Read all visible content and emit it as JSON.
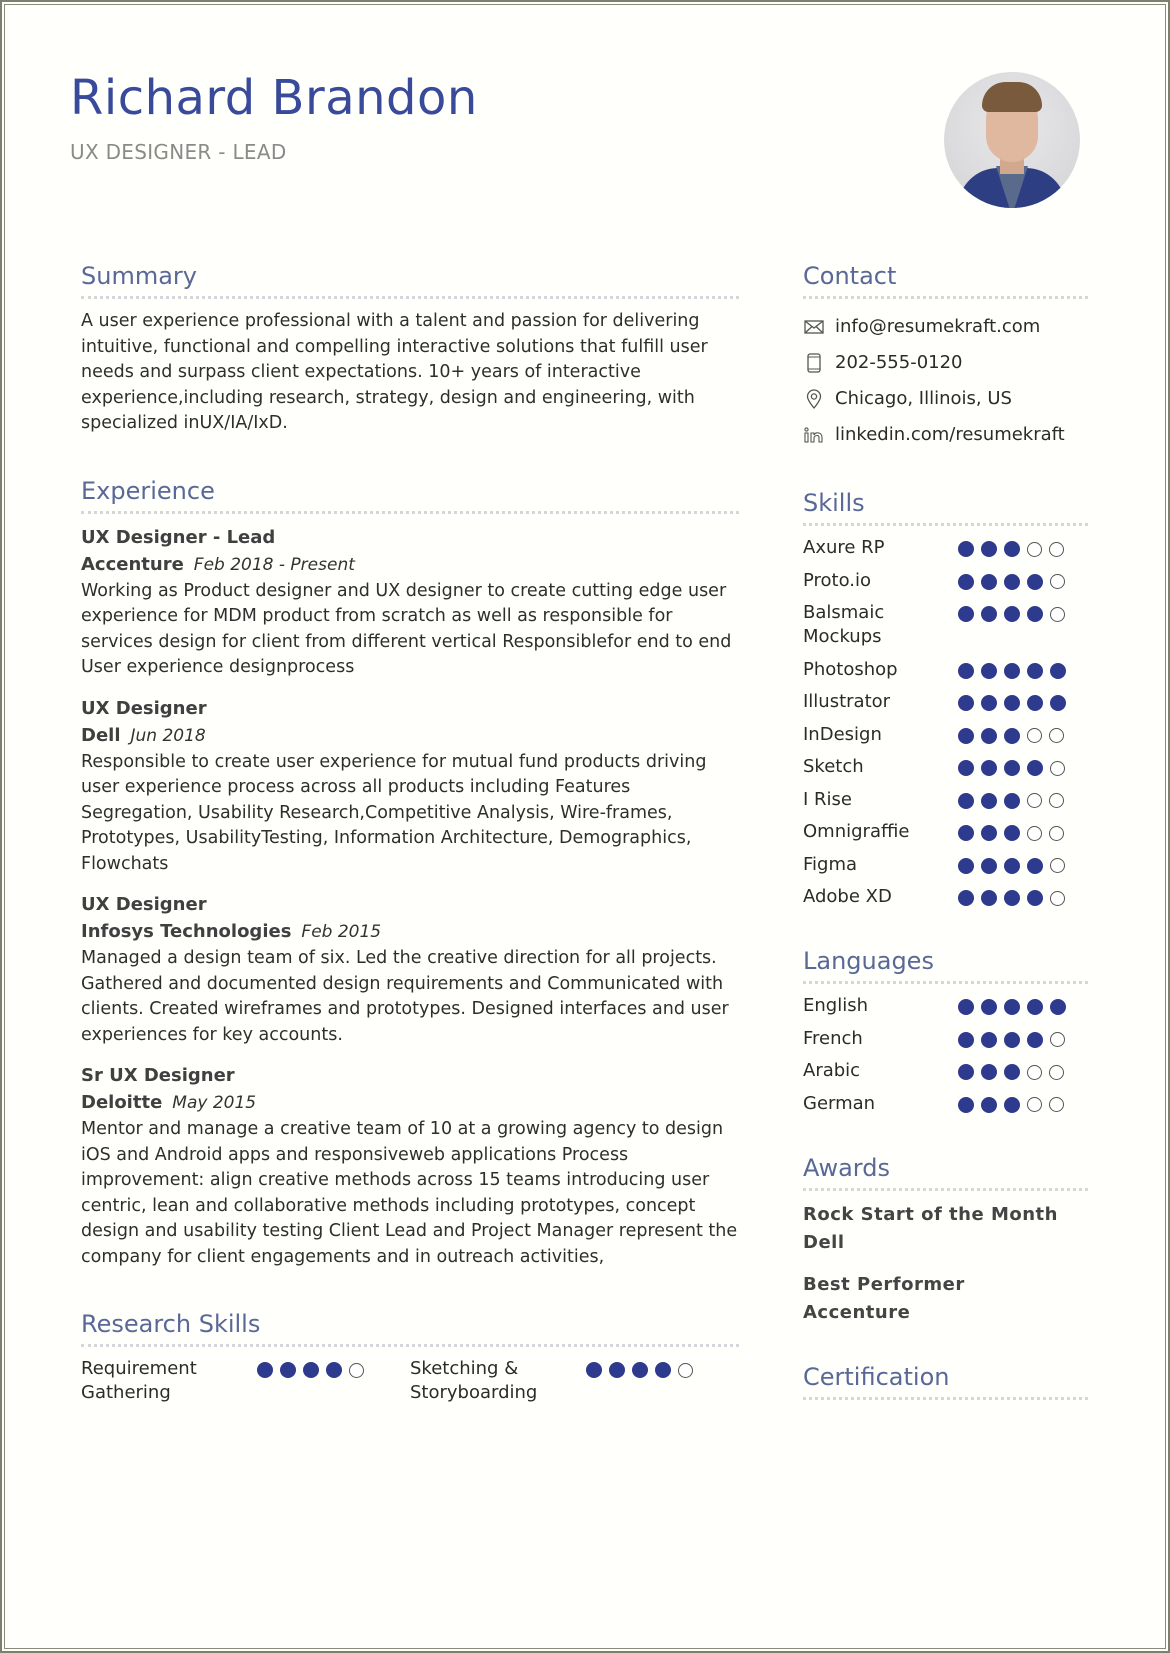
{
  "header": {
    "name": "Richard Brandon",
    "title": "UX DESIGNER - LEAD",
    "photo_icon": "profile-photo"
  },
  "colors": {
    "accent": "#3a4a9a",
    "heading": "#5a6898",
    "dot_filled": "#2e3a8e"
  },
  "summary": {
    "heading": "Summary",
    "text": "A user experience professional with a talent and passion for delivering intuitive, functional and compelling interactive solutions that fulfill user needs and surpass client expectations. 10+ years of interactive experience,including research, strategy, design and engineering, with specialized inUX/IA/IxD."
  },
  "experience": {
    "heading": "Experience",
    "jobs": [
      {
        "title": "UX Designer - Lead",
        "company": "Accenture",
        "date": "Feb 2018 - Present",
        "description": "Working as Product designer and UX designer to create cutting edge user experience for MDM product from scratch as well as responsible for services design for client from different vertical Responsiblefor end to end User experience designprocess"
      },
      {
        "title": "UX Designer",
        "company": "Dell",
        "date": "Jun 2018",
        "description": "Responsible to create user experience for mutual fund products driving user experience process across all products including Features Segregation, Usability Research,Competitive Analysis, Wire-frames, Prototypes, UsabilityTesting, Information Architecture, Demographics, Flowchats"
      },
      {
        "title": "UX Designer",
        "company": "Infosys Technologies",
        "date": "Feb 2015",
        "description": "Managed a design team of six. Led the creative direction for all projects. Gathered and documented design requirements and Communicated with clients. Created wireframes and prototypes. Designed interfaces and user experiences for key accounts."
      },
      {
        "title": "Sr UX Designer",
        "company": "Deloitte",
        "date": "May 2015",
        "description": "Mentor and manage a creative team of 10 at a growing agency to design iOS and Android apps and responsiveweb applications Process improvement: align creative methods across 15 teams introducing user centric, lean and collaborative methods including prototypes, concept design and usability testing Client Lead and Project Manager represent the company for client engagements and in outreach activities,"
      }
    ]
  },
  "research_skills": {
    "heading": "Research Skills",
    "items": [
      {
        "label": "Requirement Gathering",
        "rating": 4,
        "max": 5
      },
      {
        "label": "Sketching & Storyboarding",
        "rating": 4,
        "max": 5
      }
    ]
  },
  "contact": {
    "heading": "Contact",
    "items": [
      {
        "icon": "email-icon",
        "text": "info@resumekraft.com"
      },
      {
        "icon": "phone-icon",
        "text": "202-555-0120"
      },
      {
        "icon": "location-icon",
        "text": "Chicago, Illinois, US"
      },
      {
        "icon": "linkedin-icon",
        "text": "linkedin.com/resumekraft"
      }
    ]
  },
  "skills": {
    "heading": "Skills",
    "items": [
      {
        "label": "Axure RP",
        "rating": 3,
        "max": 5
      },
      {
        "label": "Proto.io",
        "rating": 4,
        "max": 5
      },
      {
        "label": "Balsmaic Mockups",
        "rating": 4,
        "max": 5
      },
      {
        "label": "Photoshop",
        "rating": 5,
        "max": 5
      },
      {
        "label": "Illustrator",
        "rating": 5,
        "max": 5
      },
      {
        "label": "InDesign",
        "rating": 3,
        "max": 5
      },
      {
        "label": "Sketch",
        "rating": 4,
        "max": 5
      },
      {
        "label": "I Rise",
        "rating": 3,
        "max": 5
      },
      {
        "label": "Omnigraffie",
        "rating": 3,
        "max": 5
      },
      {
        "label": "Figma",
        "rating": 4,
        "max": 5
      },
      {
        "label": "Adobe XD",
        "rating": 4,
        "max": 5
      }
    ]
  },
  "languages": {
    "heading": "Languages",
    "items": [
      {
        "label": "English",
        "rating": 5,
        "max": 5
      },
      {
        "label": "French",
        "rating": 4,
        "max": 5
      },
      {
        "label": "Arabic",
        "rating": 3,
        "max": 5
      },
      {
        "label": "German",
        "rating": 3,
        "max": 5
      }
    ]
  },
  "awards": {
    "heading": "Awards",
    "items": [
      {
        "title": "Rock Start of the Month",
        "org": "Dell"
      },
      {
        "title": "Best Performer",
        "org": "Accenture"
      }
    ]
  },
  "certification": {
    "heading": "Certification"
  }
}
